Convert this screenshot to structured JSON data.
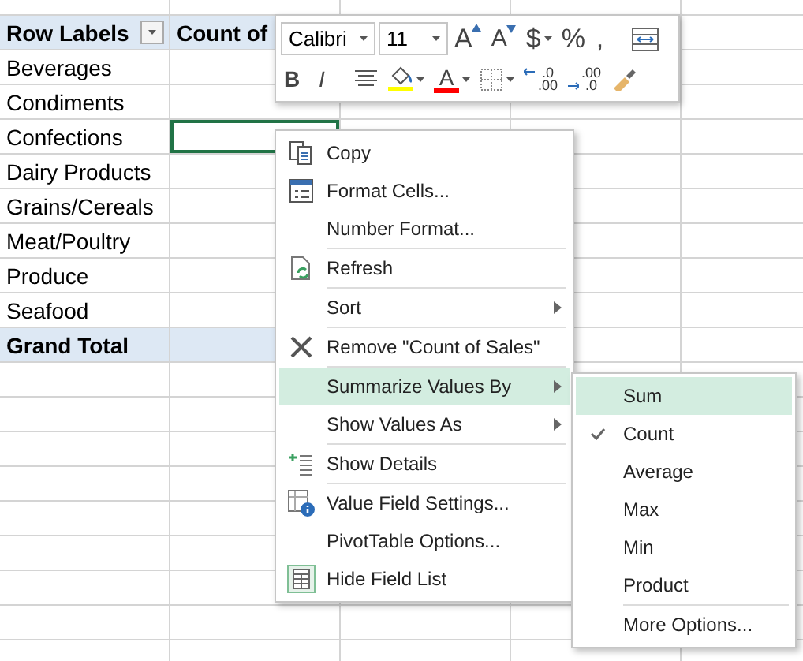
{
  "pivot": {
    "row_labels": "Row Labels",
    "value_header": "Count of",
    "rows": [
      {
        "label": "Beverages",
        "selected": false
      },
      {
        "label": "Condiments",
        "selected": false
      },
      {
        "label": "Confections",
        "selected": true
      },
      {
        "label": "Dairy Products",
        "selected": false
      },
      {
        "label": "Grains/Cereals",
        "selected": false
      },
      {
        "label": "Meat/Poultry",
        "selected": false
      },
      {
        "label": "Produce",
        "selected": false
      },
      {
        "label": "Seafood",
        "selected": false
      }
    ],
    "grand_total": "Grand Total"
  },
  "mini_toolbar": {
    "font": "Calibri",
    "size": "11",
    "row_1": [
      {
        "kind": "grow",
        "glyph": "A",
        "dropdown": false
      },
      {
        "kind": "shrink",
        "glyph": "A",
        "dropdown": false
      },
      {
        "kind": "glyph",
        "glyph": "$",
        "dropdown": true
      },
      {
        "kind": "glyph",
        "glyph": "%",
        "dropdown": false
      },
      {
        "kind": "glyph",
        "glyph": ",",
        "dropdown": false
      },
      {
        "kind": "merge",
        "dropdown": false
      }
    ],
    "row_2": [
      {
        "kind": "bold",
        "glyph": "B",
        "dropdown": false
      },
      {
        "kind": "italic",
        "glyph": "I",
        "dropdown": false
      },
      {
        "kind": "align",
        "dropdown": false
      },
      {
        "kind": "fill",
        "color": "#ffff00",
        "dropdown": true
      },
      {
        "kind": "fontcolor",
        "glyph": "A",
        "color": "#ff0000",
        "dropdown": true
      },
      {
        "kind": "borders",
        "dropdown": true
      },
      {
        "kind": "adddecimal",
        "top": ".0",
        "bottom": ".00",
        "dropdown": false
      },
      {
        "kind": "removedecimal",
        "top": ".00",
        "bottom": ".0",
        "dropdown": false
      },
      {
        "kind": "painter",
        "dropdown": false
      }
    ]
  },
  "context_menu": [
    {
      "kind": "copy",
      "label": "Copy",
      "submenu": false,
      "highlighted": false
    },
    {
      "kind": "format",
      "label": "Format Cells...",
      "submenu": false,
      "highlighted": false
    },
    {
      "kind": "plain",
      "label": "Number Format...",
      "submenu": false,
      "highlighted": false
    },
    {
      "kind": "separator"
    },
    {
      "kind": "refresh",
      "label": "Refresh",
      "submenu": false,
      "highlighted": false
    },
    {
      "kind": "separator"
    },
    {
      "kind": "plain",
      "label": "Sort",
      "submenu": true,
      "highlighted": false
    },
    {
      "kind": "separator"
    },
    {
      "kind": "remove",
      "label": "Remove \"Count of Sales\"",
      "submenu": false,
      "highlighted": false
    },
    {
      "kind": "separator"
    },
    {
      "kind": "plain",
      "label": "Summarize Values By",
      "submenu": true,
      "highlighted": true
    },
    {
      "kind": "plain",
      "label": "Show Values As",
      "submenu": true,
      "highlighted": false
    },
    {
      "kind": "separator"
    },
    {
      "kind": "details",
      "label": "Show Details",
      "submenu": false,
      "highlighted": false
    },
    {
      "kind": "separator"
    },
    {
      "kind": "settings",
      "label": "Value Field Settings...",
      "submenu": false,
      "highlighted": false
    },
    {
      "kind": "plain",
      "label": "PivotTable Options...",
      "submenu": false,
      "highlighted": false
    },
    {
      "kind": "fieldlist",
      "label": "Hide Field List",
      "submenu": false,
      "highlighted": false
    }
  ],
  "submenu": [
    {
      "kind": "item",
      "label": "Sum",
      "checked": false,
      "highlighted": true
    },
    {
      "kind": "item",
      "label": "Count",
      "checked": true,
      "highlighted": false
    },
    {
      "kind": "item",
      "label": "Average",
      "checked": false,
      "highlighted": false
    },
    {
      "kind": "item",
      "label": "Max",
      "checked": false,
      "highlighted": false
    },
    {
      "kind": "item",
      "label": "Min",
      "checked": false,
      "highlighted": false
    },
    {
      "kind": "item",
      "label": "Product",
      "checked": false,
      "highlighted": false
    },
    {
      "kind": "separator"
    },
    {
      "kind": "item",
      "label": "More Options...",
      "checked": false,
      "highlighted": false
    }
  ]
}
